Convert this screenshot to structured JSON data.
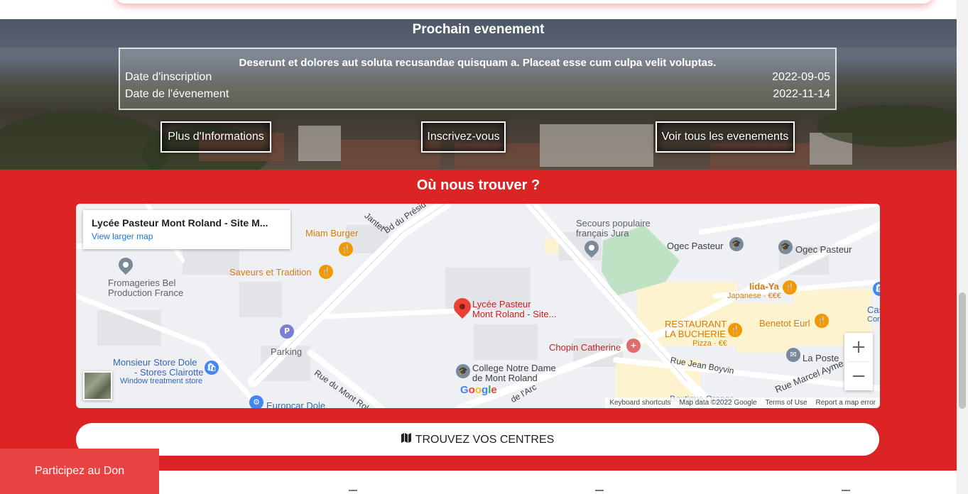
{
  "event": {
    "section_title": "Prochain evenement",
    "description": "Deserunt et dolores aut soluta recusandae quisquam a. Placeat esse cum culpa velit voluptas.",
    "rows": [
      {
        "label": "Date d'inscription",
        "value": "2022-09-05"
      },
      {
        "label": "Date de l'évenement",
        "value": "2022-11-14"
      }
    ],
    "buttons": {
      "more_info": "Plus d'Informations",
      "register": "Inscrivez-vous",
      "all_events": "Voir tous les evenements"
    }
  },
  "location": {
    "section_title": "Où nous trouver ?",
    "map": {
      "info_name": "Lycée Pasteur Mont Roland - Site M...",
      "info_link": "View larger map",
      "labels": {
        "miam_burger": "Miam Burger",
        "saveurs": "Saveurs et Tradition",
        "fromageries_1": "Fromageries Bel",
        "fromageries_2": "Production France",
        "parking": "Parking",
        "monsieur_store_1": "Monsieur Store Dole",
        "monsieur_store_2": "- Stores Clairotte",
        "monsieur_store_3": "Window treatment store",
        "europcar": "Europcar Dole",
        "lycee_1": "Lycée Pasteur",
        "lycee_2": "Mont Roland -  Site...",
        "college_1": "College Notre Dame",
        "college_2": "de Mont Roland",
        "chopin": "Chopin Catherine",
        "secours_1": "Secours populaire",
        "secours_2": "français Jura",
        "ogec_1": "Ogec Pasteur",
        "ogec_2": "Ogec Pasteur",
        "iida_1": "Iida-Ya",
        "iida_2": "Japanese · €€€",
        "restaurant_1": "RESTAURANT",
        "restaurant_2": "LA BUCHERIE",
        "restaurant_3": "Pizza · €€",
        "benetot": "Benetot Eurl",
        "la_poste": "La Poste",
        "cas": "Cas",
        "conv": "Conv",
        "bd_president": "Bd du Présid",
        "jantet": "Jantet",
        "rue_mont_roland": "Rue du Mont Roland",
        "rue_jean_boyvin": "Rue Jean Boyvin",
        "rue_marcel": "Rue Marcel Ayme",
        "rue_arc": "de l'Arc",
        "boutique": "Boutique Orange",
        "edge_letters": "ra"
      },
      "google": [
        "G",
        "o",
        "o",
        "g",
        "l",
        "e"
      ],
      "attribution": {
        "shortcuts": "Keyboard shortcuts",
        "data": "Map data ©2022 Google",
        "terms": "Terms of Use",
        "report": "Report a map error"
      },
      "zoom_in": "+",
      "zoom_out": "−"
    },
    "centres_button": "TROUVEZ VOS CENTRES"
  },
  "donate_button": "Participez au Don",
  "colors": {
    "brand_red": "#dd2424",
    "donate_red": "#e74343",
    "map_pin_red": "#ea4335",
    "poi_orange": "#f29900",
    "poi_gray": "#7a8a9a"
  },
  "icons": {
    "map": "map-icon",
    "pin": "map-pin-icon"
  }
}
